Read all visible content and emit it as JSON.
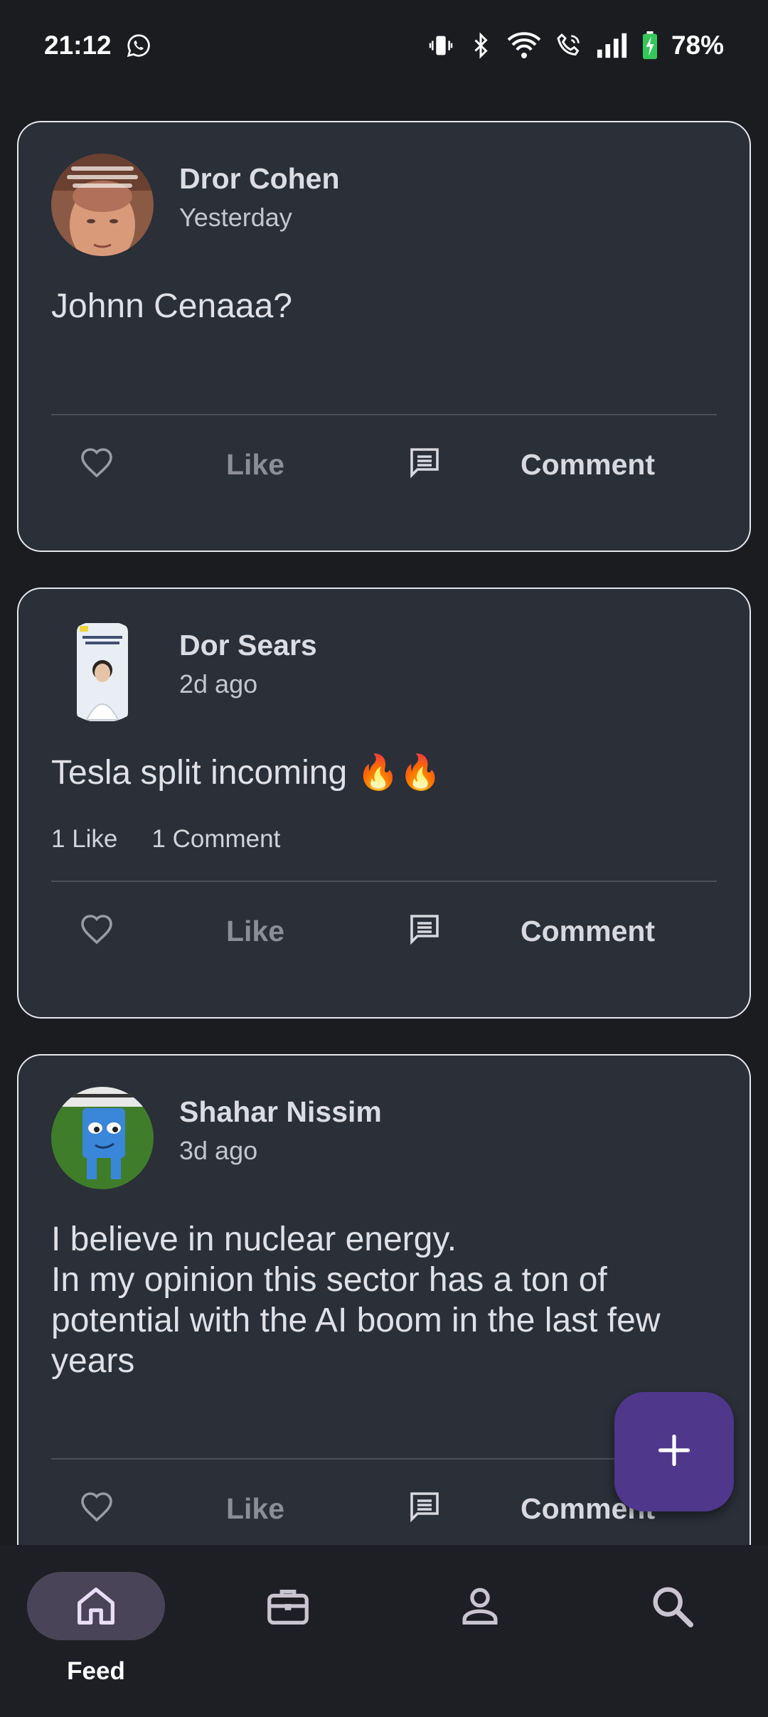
{
  "status_bar": {
    "time": "21:12",
    "battery": "78%",
    "icons": [
      "whatsapp-icon",
      "vibrate-icon",
      "bluetooth-icon",
      "wifi-icon",
      "wifi-call-icon",
      "signal-icon",
      "battery-charging-icon"
    ]
  },
  "posts": [
    {
      "author": "Dror Cohen",
      "time": "Yesterday",
      "text": "Johnn Cenaaa?",
      "like_label": "Like",
      "comment_label": "Comment"
    },
    {
      "author": "Dor Sears",
      "time": "2d ago",
      "text": "Tesla split incoming 🔥🔥",
      "likes_count": "1 Like",
      "comments_count": "1 Comment",
      "like_label": "Like",
      "comment_label": "Comment"
    },
    {
      "author": "Shahar Nissim",
      "time": "3d ago",
      "text_lines": [
        "I believe in nuclear energy.",
        "In my opinion this sector has a ton of",
        "potential with the AI boom in the last few",
        "years"
      ],
      "like_label": "Like",
      "comment_label": "Comment"
    }
  ],
  "fab": {
    "icon": "plus-icon"
  },
  "nav": [
    {
      "label": "Feed",
      "icon": "home-icon",
      "active": true
    },
    {
      "label": "",
      "icon": "briefcase-icon",
      "active": false
    },
    {
      "label": "",
      "icon": "person-icon",
      "active": false
    },
    {
      "label": "",
      "icon": "search-icon",
      "active": false
    }
  ],
  "colors": {
    "background": "#1b1c20",
    "card": "#2a2f38",
    "card_border": "#e6e7ea",
    "fab": "#4f378b",
    "nav_pill": "#4a4458"
  }
}
